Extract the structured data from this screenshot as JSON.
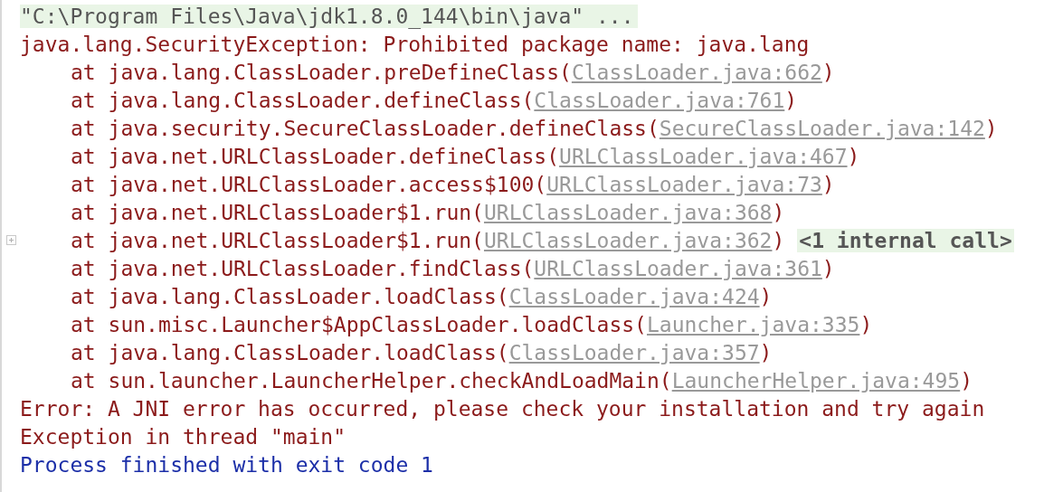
{
  "lines": [
    {
      "kind": "command",
      "text": "\"C:\\Program Files\\Java\\jdk1.8.0_144\\bin\\java\" ..."
    },
    {
      "kind": "error",
      "text": "java.lang.SecurityException: Prohibited package name: java.lang"
    },
    {
      "kind": "frame",
      "method": "at java.lang.ClassLoader.preDefineClass(",
      "link": "ClassLoader.java:662",
      "close": ")",
      "folded": false
    },
    {
      "kind": "frame",
      "method": "at java.lang.ClassLoader.defineClass(",
      "link": "ClassLoader.java:761",
      "close": ")",
      "folded": false
    },
    {
      "kind": "frame",
      "method": "at java.security.SecureClassLoader.defineClass(",
      "link": "SecureClassLoader.java:142",
      "close": ")",
      "folded": false
    },
    {
      "kind": "frame",
      "method": "at java.net.URLClassLoader.defineClass(",
      "link": "URLClassLoader.java:467",
      "close": ")",
      "folded": false
    },
    {
      "kind": "frame",
      "method": "at java.net.URLClassLoader.access$100(",
      "link": "URLClassLoader.java:73",
      "close": ")",
      "folded": false
    },
    {
      "kind": "frame",
      "method": "at java.net.URLClassLoader$1.run(",
      "link": "URLClassLoader.java:368",
      "close": ")",
      "folded": false
    },
    {
      "kind": "frame",
      "method": "at java.net.URLClassLoader$1.run(",
      "link": "URLClassLoader.java:362",
      "close": ")",
      "folded": true,
      "note": "<1 internal call>"
    },
    {
      "kind": "frame",
      "method": "at java.net.URLClassLoader.findClass(",
      "link": "URLClassLoader.java:361",
      "close": ")",
      "folded": false
    },
    {
      "kind": "frame",
      "method": "at java.lang.ClassLoader.loadClass(",
      "link": "ClassLoader.java:424",
      "close": ")",
      "folded": false
    },
    {
      "kind": "frame",
      "method": "at sun.misc.Launcher$AppClassLoader.loadClass(",
      "link": "Launcher.java:335",
      "close": ")",
      "folded": false
    },
    {
      "kind": "frame",
      "method": "at java.lang.ClassLoader.loadClass(",
      "link": "ClassLoader.java:357",
      "close": ")",
      "folded": false
    },
    {
      "kind": "frame",
      "method": "at sun.launcher.LauncherHelper.checkAndLoadMain(",
      "link": "LauncherHelper.java:495",
      "close": ")",
      "folded": false
    },
    {
      "kind": "error",
      "text": "Error: A JNI error has occurred, please check your installation and try again"
    },
    {
      "kind": "error",
      "text": "Exception in thread \"main\""
    },
    {
      "kind": "process",
      "text": "Process finished with exit code 1"
    }
  ]
}
